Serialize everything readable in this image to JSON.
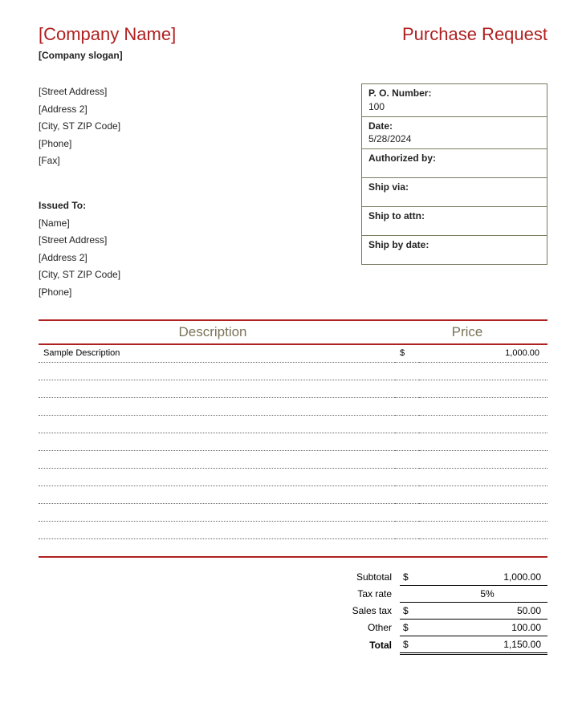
{
  "header": {
    "company_name": "[Company Name]",
    "doc_title": "Purchase Request",
    "slogan": "[Company slogan]"
  },
  "from": {
    "street": "[Street Address]",
    "address2": "[Address 2]",
    "city_line": "[City, ST  ZIP Code]",
    "phone": "[Phone]",
    "fax": "[Fax]"
  },
  "issued_to": {
    "label": "Issued To:",
    "name": "[Name]",
    "street": "[Street Address]",
    "address2": "[Address 2]",
    "city_line": "[City, ST  ZIP Code]",
    "phone": "[Phone]"
  },
  "info": {
    "po_label": "P. O. Number:",
    "po_value": "100",
    "date_label": "Date:",
    "date_value": "5/28/2024",
    "auth_label": "Authorized by:",
    "ship_via_label": "Ship via:",
    "ship_attn_label": "Ship to attn:",
    "ship_by_label": "Ship by date:"
  },
  "columns": {
    "desc": "Description",
    "price": "Price"
  },
  "line": {
    "desc": "Sample Description",
    "cur": "$",
    "amt": "1,000.00"
  },
  "totals": {
    "subtotal_label": "Subtotal",
    "subtotal_cur": "$",
    "subtotal_val": "1,000.00",
    "tax_rate_label": "Tax rate",
    "tax_rate_val": "5%",
    "sales_tax_label": "Sales tax",
    "sales_tax_cur": "$",
    "sales_tax_val": "50.00",
    "other_label": "Other",
    "other_cur": "$",
    "other_val": "100.00",
    "total_label": "Total",
    "total_cur": "$",
    "total_val": "1,150.00"
  }
}
